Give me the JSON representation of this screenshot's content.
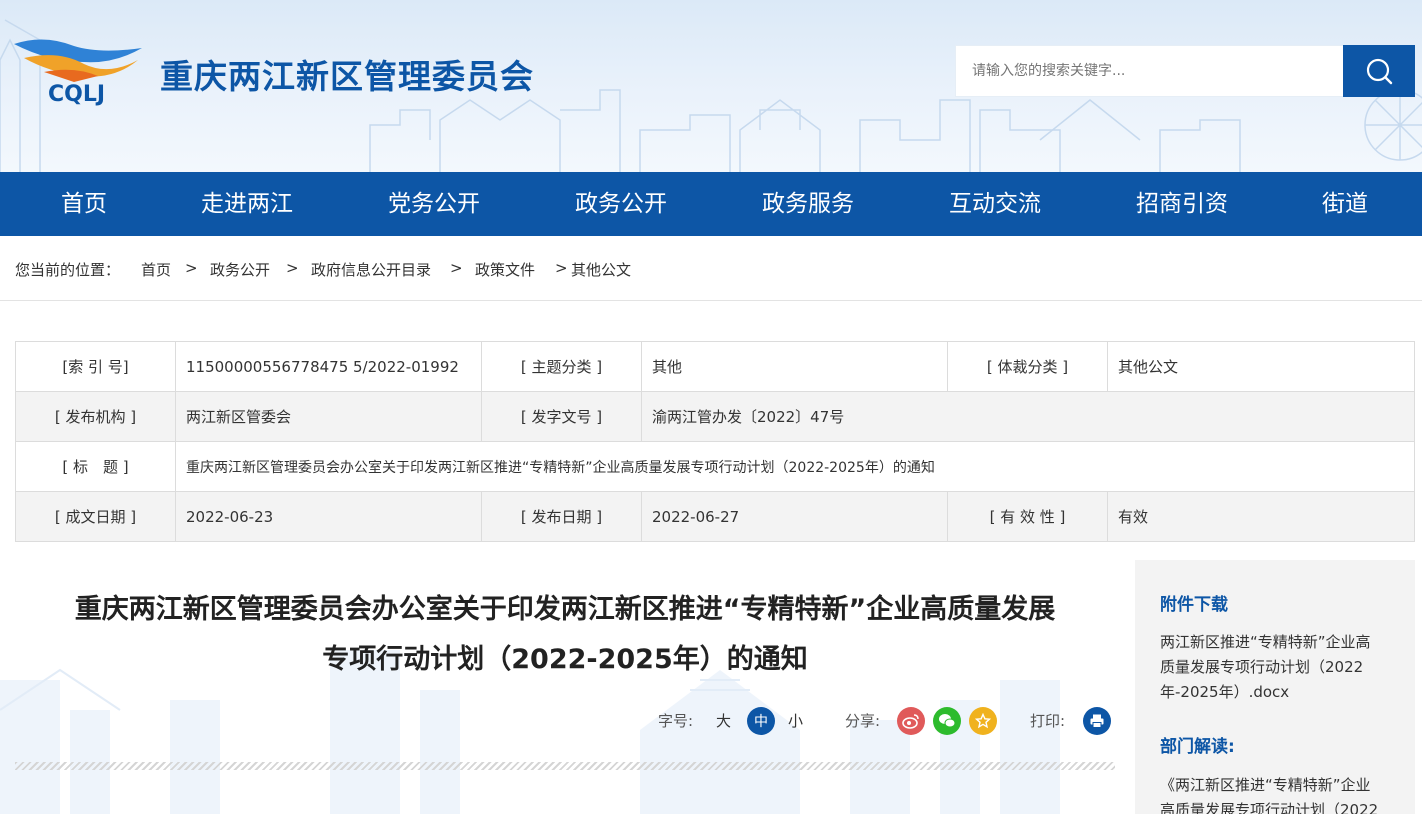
{
  "header": {
    "logo_abbr": "CQLJ",
    "site_title": "重庆两江新区管理委员会",
    "search_placeholder": "请输入您的搜索关键字..."
  },
  "nav": [
    "首页",
    "走进两江",
    "党务公开",
    "政务公开",
    "政务服务",
    "互动交流",
    "招商引资",
    "街道"
  ],
  "breadcrumb": {
    "prefix": "您当前的位置：",
    "items": [
      "首页",
      "政务公开",
      "政府信息公开目录",
      "政策文件",
      "其他公文"
    ],
    "separator": ">"
  },
  "info_table": {
    "index_no_label": "[索 引 号]",
    "index_no": "11500000556778475 5/2022-01992",
    "topic_label": "[ 主题分类 ]",
    "topic": "其他",
    "genre_label": "[ 体裁分类 ]",
    "genre": "其他公文",
    "publisher_label": "[ 发布机构 ]",
    "publisher": "两江新区管委会",
    "doc_no_label": "[ 发字文号 ]",
    "doc_no": "渝两江管办发〔2022〕47号",
    "title_label": "[ 标　题 ]",
    "title": "重庆两江新区管理委员会办公室关于印发两江新区推进“专精特新”企业高质量发展专项行动计划（2022-2025年）的通知",
    "written_date_label": "[ 成文日期 ]",
    "written_date": "2022-06-23",
    "publish_date_label": "[ 发布日期 ]",
    "publish_date": "2022-06-27",
    "validity_label": "[ 有 效 性 ]",
    "validity": "有效"
  },
  "article": {
    "title_line1": "重庆两江新区管理委员会办公室关于印发两江新区推进“专精特新”企业高质量发展",
    "title_line2": "专项行动计划（2022-2025年）的通知",
    "font_size_label": "字号:",
    "size_large": "大",
    "size_medium": "中",
    "size_small": "小",
    "share_label": "分享:",
    "print_label": "打印:"
  },
  "sidebar": {
    "attachment_heading": "附件下载",
    "attachment_line1": "两江新区推进“专精特新”企业高",
    "attachment_line2": "质量发展专项行动计划（2022",
    "attachment_line3": "年-2025年）.docx",
    "interpretation_heading": "部门解读:",
    "interpretation_line1": "《两江新区推进“专精特新”企业",
    "interpretation_line2": "高质量发展专项行动计划（2022"
  },
  "colors": {
    "brand_blue": "#0d56a6",
    "weibo_red": "#e05a5a",
    "wechat_green": "#2dbb2d",
    "favorite_orange": "#f0b21e"
  }
}
